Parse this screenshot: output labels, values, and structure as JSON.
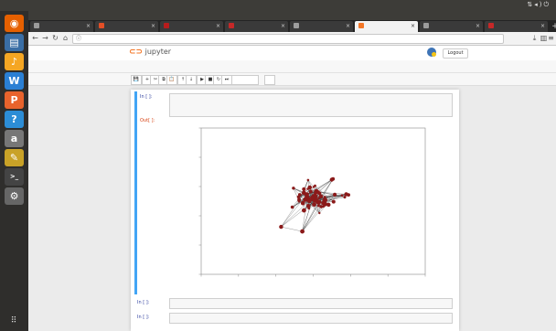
{
  "desktop": {
    "activities_label": "",
    "app_menu_label": "",
    "clock": "",
    "window_title": ""
  },
  "launcher": {
    "items": [
      {
        "name": "firefox-icon",
        "glyph": "◉",
        "color": "#e66000"
      },
      {
        "name": "files-icon",
        "glyph": "▤",
        "color": "#3a6ea5"
      },
      {
        "name": "rhythmbox-icon",
        "glyph": "♪",
        "color": "#f5a623"
      },
      {
        "name": "writer-icon",
        "glyph": "W",
        "color": "#2a7fd4"
      },
      {
        "name": "impress-icon",
        "glyph": "P",
        "color": "#e8632c"
      },
      {
        "name": "help-icon",
        "glyph": "?",
        "color": "#2c8dd6"
      },
      {
        "name": "amazon-icon",
        "glyph": "a",
        "color": "#777777"
      },
      {
        "name": "text-editor-icon",
        "glyph": "✎",
        "color": "#c9a227"
      },
      {
        "name": "terminal-icon",
        "glyph": ">_",
        "color": "#444444"
      },
      {
        "name": "settings-icon",
        "glyph": "⚙",
        "color": "#666666"
      }
    ]
  },
  "browser": {
    "tabs": [
      {
        "title": "",
        "color": "#9b9b9b"
      },
      {
        "title": "",
        "color": "#e34f26"
      },
      {
        "title": "",
        "color": "#b71c1c"
      },
      {
        "title": "",
        "color": "#c62828"
      },
      {
        "title": "",
        "color": "#9e9e9e"
      },
      {
        "title": "",
        "color": "#f37626",
        "active": true
      },
      {
        "title": "",
        "color": "#9b9b9b"
      },
      {
        "title": "",
        "color": "#c62828"
      }
    ],
    "url": "",
    "zoom": ""
  },
  "jupyter": {
    "notebook_name": "",
    "logout_label": "Logout",
    "menu": [
      "",
      "",
      "",
      "",
      "",
      "",
      "",
      ""
    ],
    "trusted_label": "",
    "kernel_label": "",
    "toolbar_buttons": [
      "💾",
      "+",
      "✂",
      "⧉",
      "📋",
      "↑",
      "↓",
      "▶",
      "■",
      "↻",
      "⏭"
    ],
    "cell_type": "",
    "cells": [
      {
        "in_prompt": "In [ ]:",
        "code": [
          "",
          "",
          ""
        ],
        "out_prompt": "Out[ ]:"
      },
      {
        "in_prompt": "In [ ]:"
      },
      {
        "in_prompt": "In [ ]:"
      }
    ]
  },
  "colors": {
    "accent": "#42a5f5",
    "node": "#8b1a1a",
    "edge": "#333333",
    "jupyter_orange": "#f37626"
  }
}
